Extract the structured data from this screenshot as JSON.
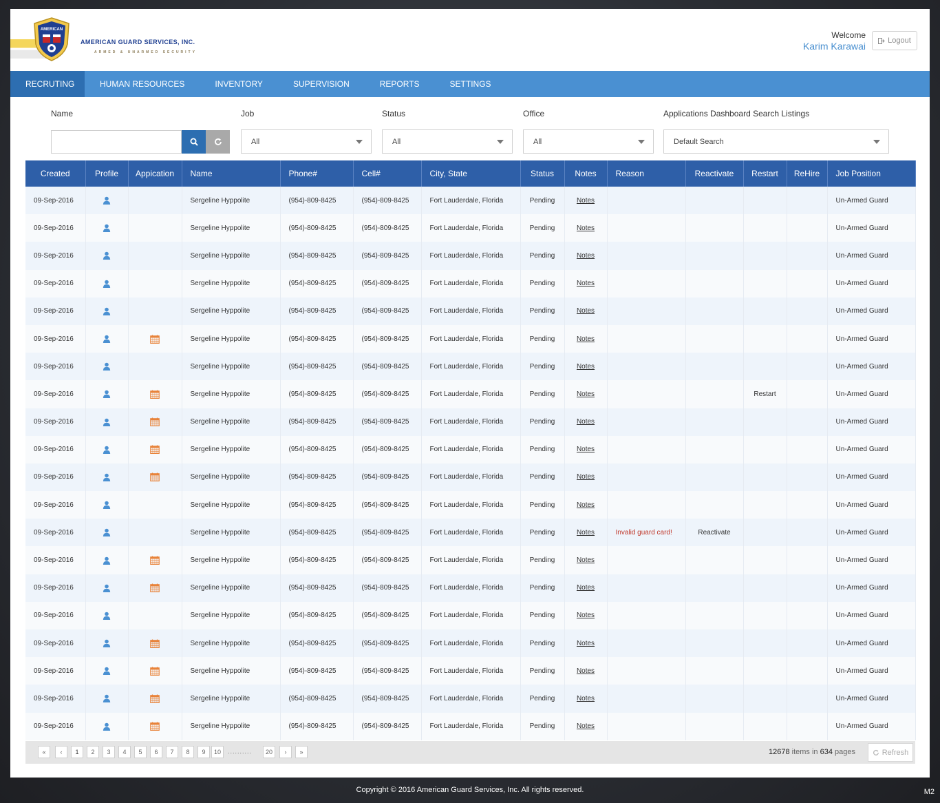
{
  "brand": {
    "badge_text": "AMERICAN",
    "name": "AMERICAN GUARD SERVICES, INC.",
    "tagline": "ARMED & UNARMED SECURITY",
    "navy": "#1f3f91",
    "gold": "#f4d65c"
  },
  "header": {
    "welcome_label": "Welcome",
    "user_name": "Karim Karawai",
    "logout_label": "Logout"
  },
  "nav": {
    "items": [
      "RECRUTING",
      "HUMAN RESOURCES",
      "INVENTORY",
      "SUPERVISION",
      "REPORTS",
      "SETTINGS"
    ],
    "active": "RECRUTING",
    "color": "#4a90d2",
    "active_color": "#2d6eb1"
  },
  "filters": {
    "name_label": "Name",
    "name_value": "",
    "job_label": "Job",
    "job_value": "All",
    "status_label": "Status",
    "status_value": "All",
    "office_label": "Office",
    "office_value": "All",
    "search_listings_label": "Applications Dashboard Search Listings",
    "search_listings_value": "Default Search"
  },
  "table": {
    "header_color": "#2e5fa8",
    "columns": [
      "Created",
      "Profile",
      "Appication",
      "Name",
      "Phone#",
      "Cell#",
      "City, State",
      "Status",
      "Notes",
      "Reason",
      "Reactivate",
      "Restart",
      "ReHire",
      "Job Position"
    ],
    "rows": [
      {
        "created": "09-Sep-2016",
        "application": false,
        "name": "Sergeline Hyppolite",
        "phone": "(954)-809-8425",
        "cell": "(954)-809-8425",
        "city": "Fort Lauderdale, Florida",
        "status": "Pending",
        "notes": "Notes",
        "reason": "",
        "reactivate": "",
        "restart": "",
        "rehire": "",
        "position": "Un-Armed Guard"
      },
      {
        "created": "09-Sep-2016",
        "application": false,
        "name": "Sergeline Hyppolite",
        "phone": "(954)-809-8425",
        "cell": "(954)-809-8425",
        "city": "Fort Lauderdale, Florida",
        "status": "Pending",
        "notes": "Notes",
        "reason": "",
        "reactivate": "",
        "restart": "",
        "rehire": "",
        "position": "Un-Armed Guard"
      },
      {
        "created": "09-Sep-2016",
        "application": false,
        "name": "Sergeline Hyppolite",
        "phone": "(954)-809-8425",
        "cell": "(954)-809-8425",
        "city": "Fort Lauderdale, Florida",
        "status": "Pending",
        "notes": "Notes",
        "reason": "",
        "reactivate": "",
        "restart": "",
        "rehire": "",
        "position": "Un-Armed Guard"
      },
      {
        "created": "09-Sep-2016",
        "application": false,
        "name": "Sergeline Hyppolite",
        "phone": "(954)-809-8425",
        "cell": "(954)-809-8425",
        "city": "Fort Lauderdale, Florida",
        "status": "Pending",
        "notes": "Notes",
        "reason": "",
        "reactivate": "",
        "restart": "",
        "rehire": "",
        "position": "Un-Armed Guard"
      },
      {
        "created": "09-Sep-2016",
        "application": false,
        "name": "Sergeline Hyppolite",
        "phone": "(954)-809-8425",
        "cell": "(954)-809-8425",
        "city": "Fort Lauderdale, Florida",
        "status": "Pending",
        "notes": "Notes",
        "reason": "",
        "reactivate": "",
        "restart": "",
        "rehire": "",
        "position": "Un-Armed Guard"
      },
      {
        "created": "09-Sep-2016",
        "application": true,
        "name": "Sergeline Hyppolite",
        "phone": "(954)-809-8425",
        "cell": "(954)-809-8425",
        "city": "Fort Lauderdale, Florida",
        "status": "Pending",
        "notes": "Notes",
        "reason": "",
        "reactivate": "",
        "restart": "",
        "rehire": "",
        "position": "Un-Armed Guard"
      },
      {
        "created": "09-Sep-2016",
        "application": false,
        "name": "Sergeline Hyppolite",
        "phone": "(954)-809-8425",
        "cell": "(954)-809-8425",
        "city": "Fort Lauderdale, Florida",
        "status": "Pending",
        "notes": "Notes",
        "reason": "",
        "reactivate": "",
        "restart": "",
        "rehire": "",
        "position": "Un-Armed Guard"
      },
      {
        "created": "09-Sep-2016",
        "application": true,
        "name": "Sergeline Hyppolite",
        "phone": "(954)-809-8425",
        "cell": "(954)-809-8425",
        "city": "Fort Lauderdale, Florida",
        "status": "Pending",
        "notes": "Notes",
        "reason": "",
        "reactivate": "",
        "restart": "Restart",
        "rehire": "",
        "position": "Un-Armed Guard"
      },
      {
        "created": "09-Sep-2016",
        "application": true,
        "name": "Sergeline Hyppolite",
        "phone": "(954)-809-8425",
        "cell": "(954)-809-8425",
        "city": "Fort Lauderdale, Florida",
        "status": "Pending",
        "notes": "Notes",
        "reason": "",
        "reactivate": "",
        "restart": "",
        "rehire": "",
        "position": "Un-Armed Guard"
      },
      {
        "created": "09-Sep-2016",
        "application": true,
        "name": "Sergeline Hyppolite",
        "phone": "(954)-809-8425",
        "cell": "(954)-809-8425",
        "city": "Fort Lauderdale, Florida",
        "status": "Pending",
        "notes": "Notes",
        "reason": "",
        "reactivate": "",
        "restart": "",
        "rehire": "",
        "position": "Un-Armed Guard"
      },
      {
        "created": "09-Sep-2016",
        "application": true,
        "name": "Sergeline Hyppolite",
        "phone": "(954)-809-8425",
        "cell": "(954)-809-8425",
        "city": "Fort Lauderdale, Florida",
        "status": "Pending",
        "notes": "Notes",
        "reason": "",
        "reactivate": "",
        "restart": "",
        "rehire": "",
        "position": "Un-Armed Guard"
      },
      {
        "created": "09-Sep-2016",
        "application": false,
        "name": "Sergeline Hyppolite",
        "phone": "(954)-809-8425",
        "cell": "(954)-809-8425",
        "city": "Fort Lauderdale, Florida",
        "status": "Pending",
        "notes": "Notes",
        "reason": "",
        "reactivate": "",
        "restart": "",
        "rehire": "",
        "position": "Un-Armed Guard"
      },
      {
        "created": "09-Sep-2016",
        "application": false,
        "name": "Sergeline Hyppolite",
        "phone": "(954)-809-8425",
        "cell": "(954)-809-8425",
        "city": "Fort Lauderdale, Florida",
        "status": "Pending",
        "notes": "Notes",
        "reason": "Invalid guard card!",
        "reactivate": "Reactivate",
        "restart": "",
        "rehire": "",
        "position": "Un-Armed Guard"
      },
      {
        "created": "09-Sep-2016",
        "application": true,
        "name": "Sergeline Hyppolite",
        "phone": "(954)-809-8425",
        "cell": "(954)-809-8425",
        "city": "Fort Lauderdale, Florida",
        "status": "Pending",
        "notes": "Notes",
        "reason": "",
        "reactivate": "",
        "restart": "",
        "rehire": "",
        "position": "Un-Armed Guard"
      },
      {
        "created": "09-Sep-2016",
        "application": true,
        "name": "Sergeline Hyppolite",
        "phone": "(954)-809-8425",
        "cell": "(954)-809-8425",
        "city": "Fort Lauderdale, Florida",
        "status": "Pending",
        "notes": "Notes",
        "reason": "",
        "reactivate": "",
        "restart": "",
        "rehire": "",
        "position": "Un-Armed Guard"
      },
      {
        "created": "09-Sep-2016",
        "application": false,
        "name": "Sergeline Hyppolite",
        "phone": "(954)-809-8425",
        "cell": "(954)-809-8425",
        "city": "Fort Lauderdale, Florida",
        "status": "Pending",
        "notes": "Notes",
        "reason": "",
        "reactivate": "",
        "restart": "",
        "rehire": "",
        "position": "Un-Armed Guard"
      },
      {
        "created": "09-Sep-2016",
        "application": true,
        "name": "Sergeline Hyppolite",
        "phone": "(954)-809-8425",
        "cell": "(954)-809-8425",
        "city": "Fort Lauderdale, Florida",
        "status": "Pending",
        "notes": "Notes",
        "reason": "",
        "reactivate": "",
        "restart": "",
        "rehire": "",
        "position": "Un-Armed Guard"
      },
      {
        "created": "09-Sep-2016",
        "application": true,
        "name": "Sergeline Hyppolite",
        "phone": "(954)-809-8425",
        "cell": "(954)-809-8425",
        "city": "Fort Lauderdale, Florida",
        "status": "Pending",
        "notes": "Notes",
        "reason": "",
        "reactivate": "",
        "restart": "",
        "rehire": "",
        "position": "Un-Armed Guard"
      },
      {
        "created": "09-Sep-2016",
        "application": true,
        "name": "Sergeline Hyppolite",
        "phone": "(954)-809-8425",
        "cell": "(954)-809-8425",
        "city": "Fort Lauderdale, Florida",
        "status": "Pending",
        "notes": "Notes",
        "reason": "",
        "reactivate": "",
        "restart": "",
        "rehire": "",
        "position": "Un-Armed Guard"
      },
      {
        "created": "09-Sep-2016",
        "application": true,
        "name": "Sergeline Hyppolite",
        "phone": "(954)-809-8425",
        "cell": "(954)-809-8425",
        "city": "Fort Lauderdale, Florida",
        "status": "Pending",
        "notes": "Notes",
        "reason": "",
        "reactivate": "",
        "restart": "",
        "rehire": "",
        "position": "Un-Armed Guard"
      }
    ],
    "reason_color": "#c0392b",
    "profile_icon": "user-icon",
    "application_icon": "calendar-icon"
  },
  "pager": {
    "first": "«",
    "prev": "‹",
    "pages": [
      "1",
      "2",
      "3",
      "4",
      "5",
      "6",
      "7",
      "8",
      "9",
      "10"
    ],
    "dots": "..........",
    "last_page": "20",
    "next": "›",
    "last": "»",
    "total_items": "12678",
    "items_label": "items in",
    "total_pages": "634",
    "pages_label": "pages",
    "refresh_label": "Refresh"
  },
  "footer": {
    "copyright": "Copyright  ©  2016  American Guard Services, Inc.   All rights reserved.",
    "tag": "M2"
  }
}
